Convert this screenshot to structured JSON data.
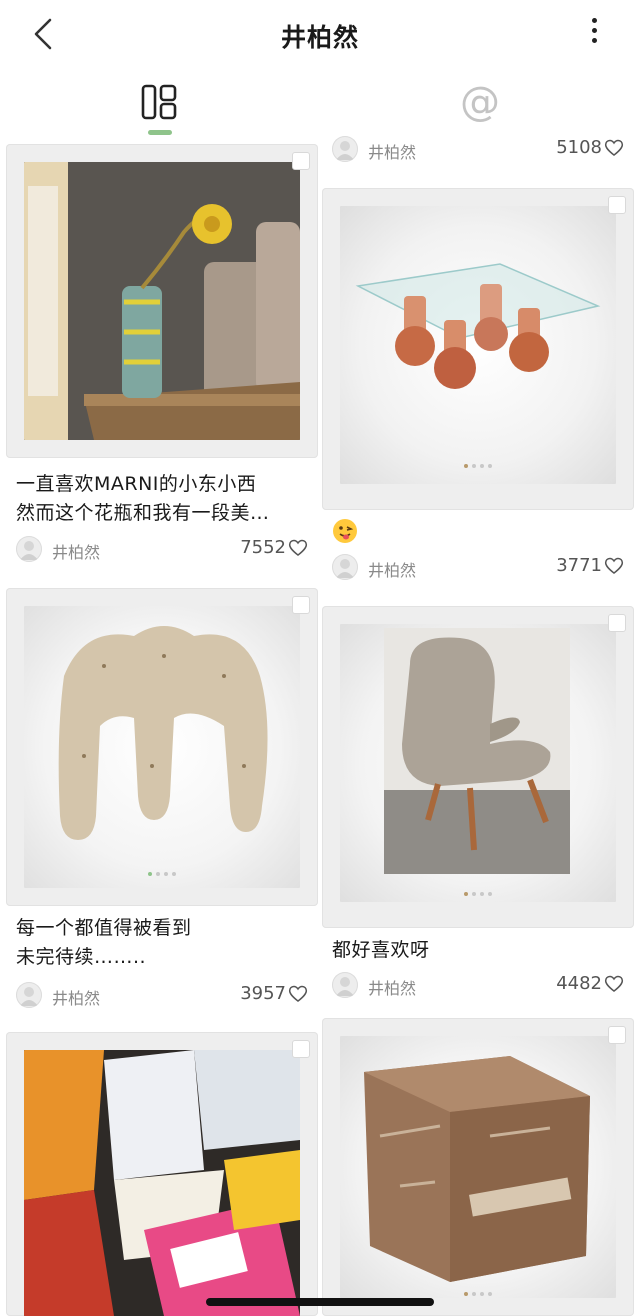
{
  "header": {
    "title": "井柏然",
    "back_icon": "chevron-left-icon",
    "more_icon": "vertical-ellipsis-icon"
  },
  "tabs": [
    {
      "icon": "grid-layout-icon",
      "active": true
    },
    {
      "icon": "at-sign-icon",
      "glyph": "@",
      "active": false
    }
  ],
  "colors": {
    "tab_indicator": "#8fc48b",
    "card_frame": "#eeeeee",
    "author_text": "#8a8a8a"
  },
  "feed": {
    "right_partial": {
      "author": "井柏然",
      "likes": "5108"
    },
    "left": [
      {
        "image": "yellow-flower-in-textured-vase",
        "title_line1": "一直喜欢MARNI的小东小西",
        "title_line2": "然而这个花瓶和我有一段美…",
        "author": "井柏然",
        "likes": "7552"
      },
      {
        "image": "speckled-stone-stool",
        "title_line1": "每一个都值得被看到",
        "title_line2": "未完待续……..",
        "author": "井柏然",
        "likes": "3957"
      },
      {
        "image": "pile-of-snack-bags"
      }
    ],
    "right": [
      {
        "image": "glass-table-with-terracotta-vases",
        "emoji": "tongue-out-face",
        "author": "井柏然",
        "likes": "3771"
      },
      {
        "image": "fluffy-armchair",
        "title_line1": "都好喜欢呀",
        "author": "井柏然",
        "likes": "4482"
      },
      {
        "image": "taped-cardboard-cube"
      }
    ]
  }
}
